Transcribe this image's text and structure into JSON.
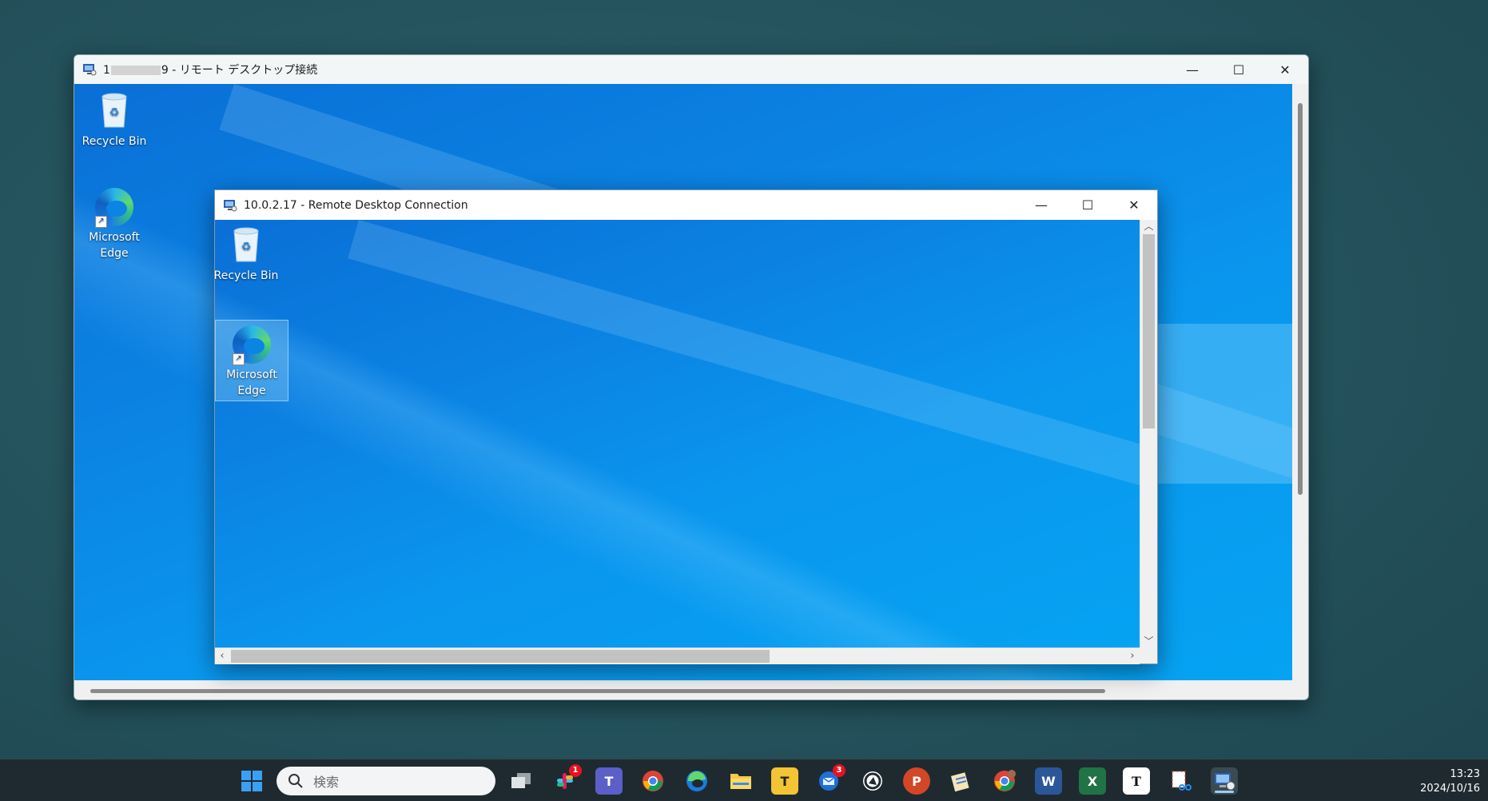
{
  "outer_window": {
    "title_prefix": "1",
    "title_suffix": "9 - リモート デスクトップ接続",
    "controls": {
      "minimize": "—",
      "maximize": "☐",
      "close": "✕"
    },
    "desktop_icons": [
      {
        "label": "Recycle Bin"
      },
      {
        "label": "Microsoft Edge"
      }
    ]
  },
  "inner_window": {
    "title": "10.0.2.17 - Remote Desktop Connection",
    "controls": {
      "minimize": "—",
      "maximize": "☐",
      "close": "✕"
    },
    "desktop_icons": [
      {
        "label": "Recycle Bin"
      },
      {
        "label": "Microsoft Edge",
        "selected": true
      }
    ]
  },
  "taskbar": {
    "search_placeholder": "検索",
    "apps": [
      {
        "name": "start-icon"
      },
      {
        "name": "task-view-icon"
      },
      {
        "name": "slack-icon",
        "badge": "1"
      },
      {
        "name": "teams-icon",
        "letter": "T"
      },
      {
        "name": "chrome-icon"
      },
      {
        "name": "edge-icon"
      },
      {
        "name": "file-explorer-icon"
      },
      {
        "name": "t-app-icon",
        "letter": "T"
      },
      {
        "name": "thunderbird-icon",
        "badge": "3"
      },
      {
        "name": "circle-app-icon"
      },
      {
        "name": "powerpoint-icon",
        "letter": "P"
      },
      {
        "name": "notepad-icon"
      },
      {
        "name": "chrome-profile-icon"
      },
      {
        "name": "word-icon",
        "letter": "W"
      },
      {
        "name": "excel-icon",
        "letter": "X"
      },
      {
        "name": "typora-icon",
        "letter": "T"
      },
      {
        "name": "snipping-tool-icon"
      },
      {
        "name": "remote-desktop-icon"
      }
    ],
    "clock": {
      "time": "13:23",
      "date": "2024/10/16"
    }
  }
}
